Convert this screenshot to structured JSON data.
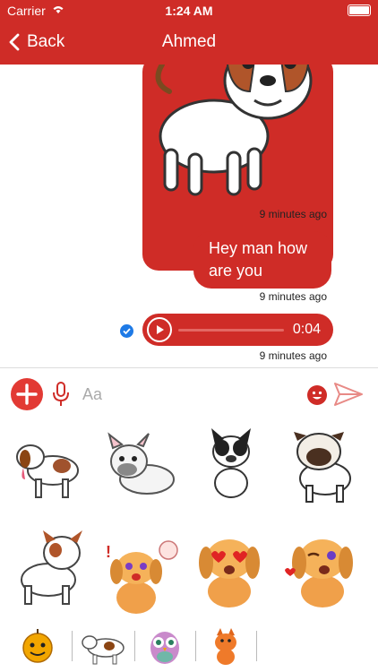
{
  "status_bar": {
    "carrier": "Carrier",
    "time": "1:24 AM"
  },
  "nav": {
    "back_label": "Back",
    "title": "Ahmed"
  },
  "messages": [
    {
      "type": "sticker",
      "timestamp": "9 minutes ago"
    },
    {
      "type": "text",
      "text_line1": "Hey man how",
      "text_line2": "are you",
      "timestamp": "9 minutes ago"
    },
    {
      "type": "audio",
      "duration": "0:04",
      "timestamp": "9 minutes ago"
    }
  ],
  "composer": {
    "placeholder": "Aa"
  },
  "colors": {
    "brand": "#cf2c27",
    "bubble_text": "#ffffff",
    "read_check": "#1e7ae6"
  },
  "icons": {
    "back": "chevron-left-icon",
    "add": "plus-icon",
    "mic": "microphone-icon",
    "emoji": "smiley-icon",
    "send": "send-icon",
    "play": "play-icon"
  },
  "sticker_grid": [
    "dog-beagle-tongue-out",
    "dog-french-bulldog-lying",
    "dog-boston-terrier-sitting",
    "dog-pug-standing",
    "dog-french-bulldog-standing",
    "dog-puppy-love-struck",
    "dog-puppy-heart-eyes",
    "dog-puppy-winking"
  ],
  "sticker_packs": [
    "pumpkin-face-pack",
    "cow-pack",
    "owl-pack",
    "fox-pack"
  ]
}
